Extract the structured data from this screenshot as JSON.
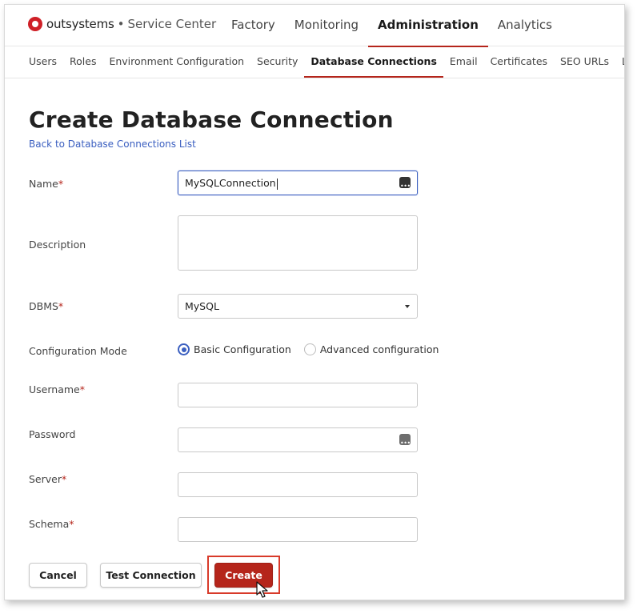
{
  "header": {
    "brand": "outsystems",
    "separator": "•",
    "product": "Service Center",
    "nav": [
      {
        "label": "Factory",
        "active": false
      },
      {
        "label": "Monitoring",
        "active": false
      },
      {
        "label": "Administration",
        "active": true
      },
      {
        "label": "Analytics",
        "active": false
      }
    ]
  },
  "subnav": [
    {
      "label": "Users",
      "active": false
    },
    {
      "label": "Roles",
      "active": false
    },
    {
      "label": "Environment Configuration",
      "active": false
    },
    {
      "label": "Security",
      "active": false
    },
    {
      "label": "Database Connections",
      "active": true
    },
    {
      "label": "Email",
      "active": false
    },
    {
      "label": "Certificates",
      "active": false
    },
    {
      "label": "SEO URLs",
      "active": false
    },
    {
      "label": "Licensing",
      "active": false
    }
  ],
  "page": {
    "title": "Create Database Connection",
    "back_link": "Back to Database Connections List"
  },
  "form": {
    "required_mark": "*",
    "name": {
      "label": "Name",
      "value": "MySQLConnection"
    },
    "description": {
      "label": "Description",
      "value": ""
    },
    "dbms": {
      "label": "DBMS",
      "value": "MySQL"
    },
    "config_mode": {
      "label": "Configuration Mode",
      "options": [
        {
          "label": "Basic Configuration",
          "checked": true
        },
        {
          "label": "Advanced configuration",
          "checked": false
        }
      ]
    },
    "username": {
      "label": "Username",
      "value": ""
    },
    "password": {
      "label": "Password",
      "value": ""
    },
    "server": {
      "label": "Server",
      "value": ""
    },
    "schema": {
      "label": "Schema",
      "value": ""
    }
  },
  "actions": {
    "cancel": "Cancel",
    "test": "Test Connection",
    "create": "Create"
  },
  "colors": {
    "accent": "#b5251b",
    "link": "#3b5fc0",
    "highlight": "#d83a2a"
  }
}
